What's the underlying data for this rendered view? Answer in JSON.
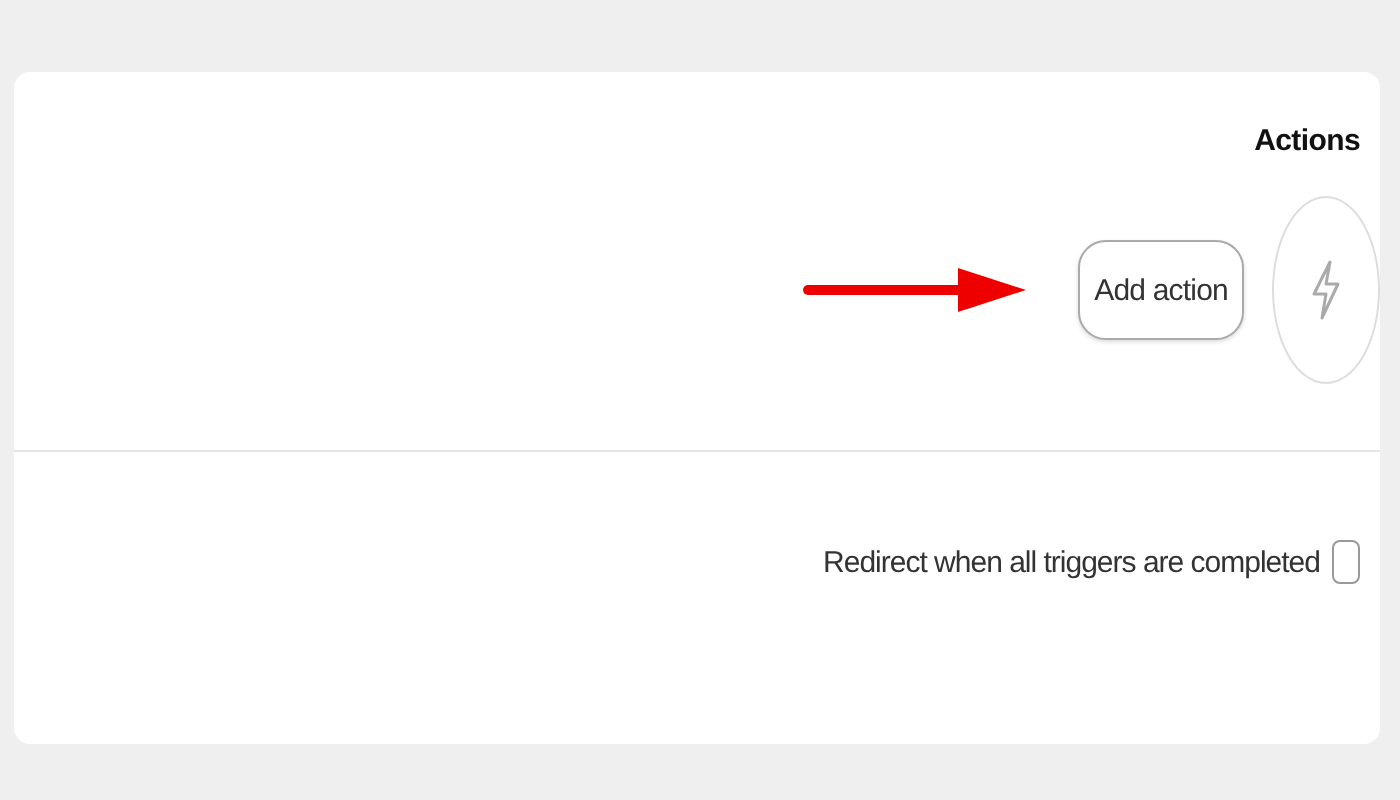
{
  "panel": {
    "title": "Actions"
  },
  "add_button": {
    "label": "Add action"
  },
  "redirect_option": {
    "label": "Redirect when all triggers are completed",
    "checked": false
  }
}
